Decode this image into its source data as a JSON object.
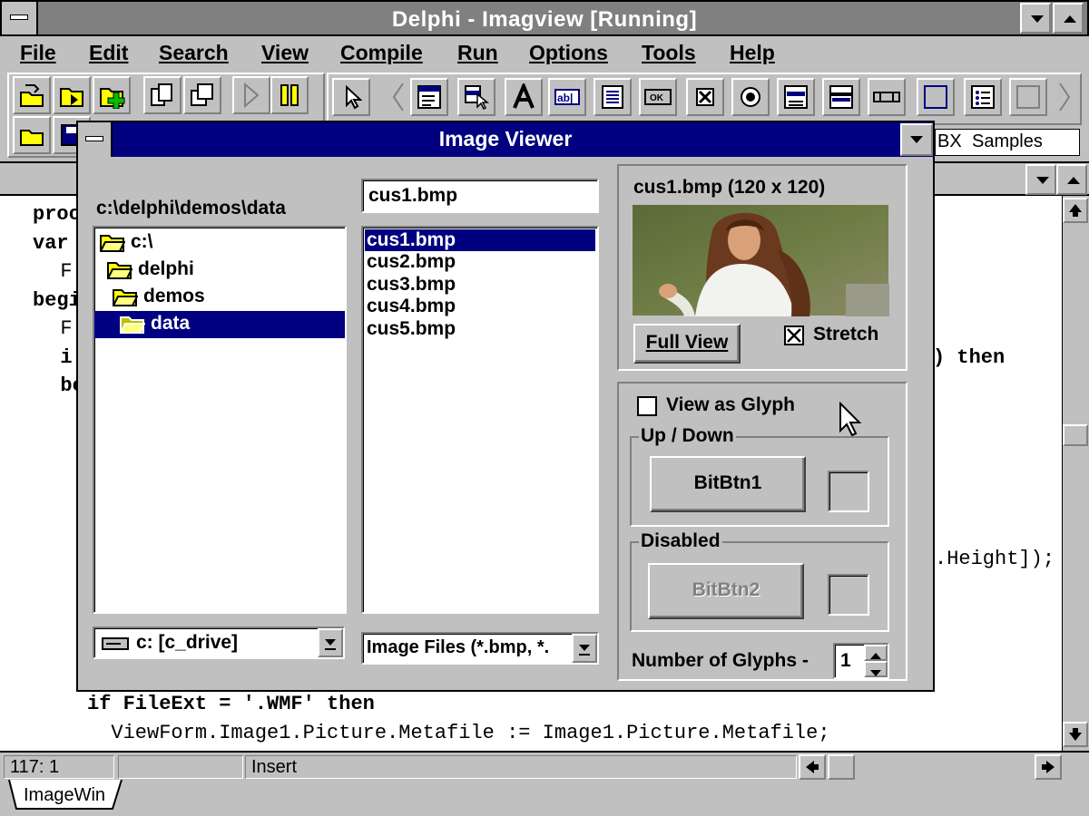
{
  "main_window": {
    "title": "Delphi - Imagview [Running]",
    "menu": [
      "File",
      "Edit",
      "Search",
      "View",
      "Compile",
      "Run",
      "Options",
      "Tools",
      "Help"
    ],
    "menu_mnemonic_index": [
      0,
      0,
      0,
      0,
      0,
      0,
      0,
      0,
      0
    ],
    "palette_tabs": [
      "BX",
      "Samples"
    ]
  },
  "editor": {
    "code_lines": [
      "proc",
      "var",
      "  F",
      "begi",
      "  F",
      "  i",
      "  be"
    ],
    "right_fragments": [
      ") then",
      ".Height]);"
    ],
    "bottom_lines": [
      "if FileExt = '.WMF' then",
      "  ViewForm.Image1.Picture.Metafile := Image1.Picture.Metafile;"
    ],
    "status": {
      "position": "117:  1",
      "mode": "Insert"
    },
    "tab": "ImageWin"
  },
  "dialog": {
    "title": "Image Viewer",
    "path_label": "c:\\delphi\\demos\\data",
    "directories": [
      "c:\\",
      "delphi",
      "demos",
      "data"
    ],
    "selected_directory": "data",
    "filename_value": "cus1.bmp",
    "files": [
      "cus1.bmp",
      "cus2.bmp",
      "cus3.bmp",
      "cus4.bmp",
      "cus5.bmp"
    ],
    "selected_file": "cus1.bmp",
    "drive_value": "c: [c_drive]",
    "filter_value": "Image Files (*.bmp, *.",
    "preview_caption": "cus1.bmp (120 x 120)",
    "full_view_button": "Full View",
    "stretch_label": "Stretch",
    "stretch_checked": true,
    "view_as_glyph_label": "View as Glyph",
    "view_as_glyph_checked": false,
    "group_up_down": "Up / Down",
    "bitbtn1_label": "BitBtn1",
    "group_disabled": "Disabled",
    "bitbtn2_label": "BitBtn2",
    "glyphs_label": "Number of Glyphs -",
    "glyphs_value": "1"
  },
  "colors": {
    "active_title": "#000080",
    "inactive_title": "#808080",
    "face": "#c0c0c0",
    "selection": "#000080"
  }
}
